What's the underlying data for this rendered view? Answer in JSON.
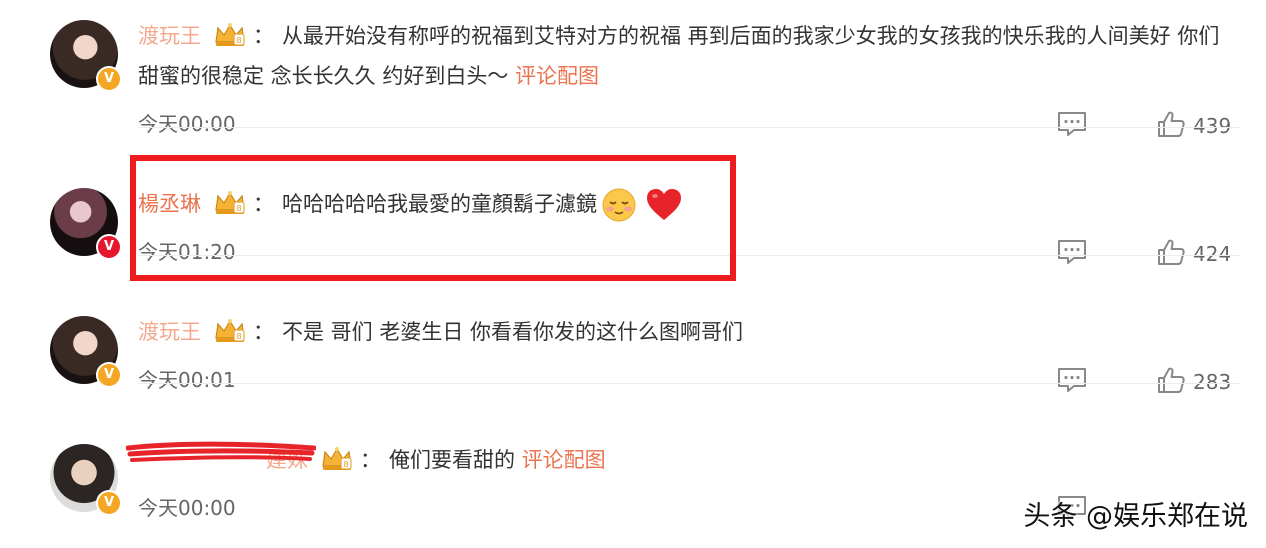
{
  "comments": [
    {
      "username": "渡玩王",
      "text": "从最开始没有称呼的祝福到艾特对方的祝福 再到后面的我家少女我的女孩我的快乐我的人间美好 你们甜蜜的很稳定 念长长久久 约好到白头～",
      "link": "评论配图",
      "time": "今天00:00",
      "likes": "439",
      "badge": "V"
    },
    {
      "username": "楊丞琳",
      "text": "哈哈哈哈哈我最愛的童顏鬍子濾鏡",
      "emoji": [
        "smile-blush",
        "red-heart"
      ],
      "time": "今天01:20",
      "likes": "424",
      "badge": "V"
    },
    {
      "username": "渡玩王",
      "text": "不是 哥们 老婆生日 你看看你发的这什么图啊哥们",
      "time": "今天00:01",
      "likes": "283",
      "badge": "V"
    },
    {
      "username": "建姝",
      "text": "俺们要看甜的",
      "link": "评论配图",
      "time": "今天00:00",
      "badge": "V"
    }
  ],
  "colon": "：",
  "watermark": "头条 @娱乐郑在说",
  "colors": {
    "username": "#eb7350",
    "highlight_box": "#ee1c1c",
    "badge_gold": "#f5a623",
    "badge_red": "#e6162d"
  }
}
